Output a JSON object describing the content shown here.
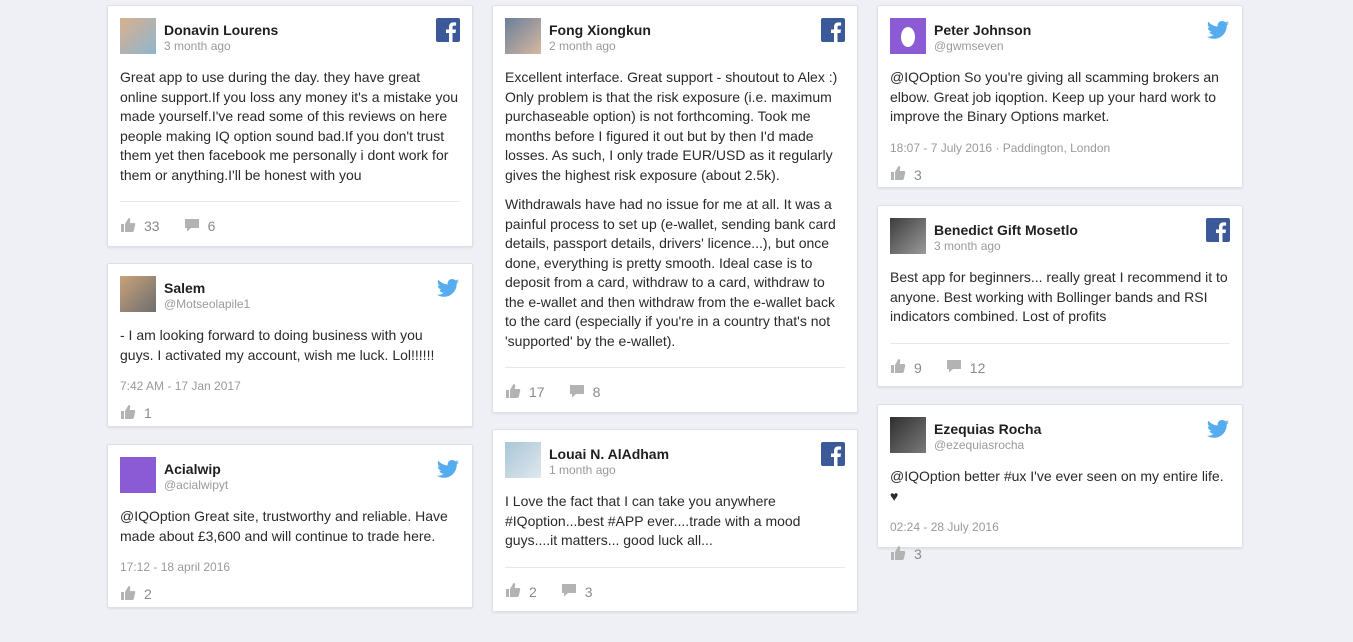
{
  "columns": [
    [
      {
        "name": "Donavin Lourens",
        "sub": "3 month ago",
        "network": "facebook",
        "paragraphs": [
          "Great app to use during the day. they have great online support.If you loss any money it's a mistake you made yourself.I've read some of this reviews on here people making IQ option sound bad.If you don't trust them yet then facebook me personally i dont work for them or anything.I'll be honest with you"
        ],
        "meta": "",
        "likes": "33",
        "comments": "6"
      },
      {
        "name": "Salem",
        "sub": "@Motseolapile1",
        "network": "twitter",
        "paragraphs": [
          "- I am looking forward to doing business with you guys. I activated my account, wish me luck. Lol!!!!!!"
        ],
        "meta": "7:42 AM - 17 Jan 2017",
        "likes": "1",
        "comments": ""
      },
      {
        "name": "Acialwip",
        "sub": "@acialwipyt",
        "network": "twitter",
        "paragraphs": [
          "@IQOption Great site, trustworthy and reliable. Have made about £3,600 and will continue to trade here."
        ],
        "meta": "17:12 - 18 april 2016",
        "likes": "2",
        "comments": ""
      }
    ],
    [
      {
        "name": "Fong Xiongkun",
        "sub": "2 month ago",
        "network": "facebook",
        "paragraphs": [
          "Excellent interface. Great support - shoutout to Alex :) Only problem is that the risk exposure (i.e. maximum purchaseable option) is not forthcoming. Took me months before I figured it out but by then I'd made losses. As such, I only trade EUR/USD as it regularly gives the highest risk exposure (about 2.5k).",
          "Withdrawals have had no issue for me at all. It was a painful process to set up (e-wallet, sending bank card details, passport details, drivers' licence...), but once done, everything is pretty smooth. Ideal case is to deposit from a card, withdraw to a card, withdraw to the e-wallet and then withdraw from the e-wallet back to the card (especially if you're in a country that's not 'supported' by the e-wallet)."
        ],
        "meta": "",
        "likes": "17",
        "comments": "8"
      },
      {
        "name": "Louai N. AlAdham",
        "sub": "1 month ago",
        "network": "facebook",
        "paragraphs": [
          "I Love the fact that I can take you anywhere #IQoption...best #APP ever....trade with a mood guys....it matters... good luck all..."
        ],
        "meta": "",
        "likes": "2",
        "comments": "3"
      }
    ],
    [
      {
        "name": "Peter Johnson",
        "sub": "@gwmseven",
        "network": "twitter",
        "paragraphs": [
          "@IQOption So you're giving all scamming brokers an elbow. Great job iqoption. Keep up your hard work to improve the Binary Options market."
        ],
        "meta": "18:07 - 7 July 2016 · Paddington, London",
        "likes": "3",
        "comments": ""
      },
      {
        "name": "Benedict Gift Mosetlo",
        "sub": "3 month ago",
        "network": "facebook",
        "paragraphs": [
          "Best app for beginners... really great I recommend it to anyone. Best working with Bollinger bands and RSI indicators combined. Lost of profits"
        ],
        "meta": "",
        "likes": "9",
        "comments": "12"
      },
      {
        "name": "Ezequias Rocha",
        "sub": "@ezequiasrocha",
        "network": "twitter",
        "paragraphs": [
          "@IQOption better #ux I've ever seen on my entire life. ♥"
        ],
        "meta": "02:24 - 28 July 2016",
        "likes": "3",
        "comments": ""
      }
    ]
  ],
  "colors": {
    "facebook": "#3b5998",
    "twitter": "#55acee",
    "background": "#eef0f6"
  },
  "icons": {
    "like": "thumbs-up-icon",
    "comment": "comment-icon",
    "facebook": "facebook-icon",
    "twitter": "twitter-icon"
  }
}
